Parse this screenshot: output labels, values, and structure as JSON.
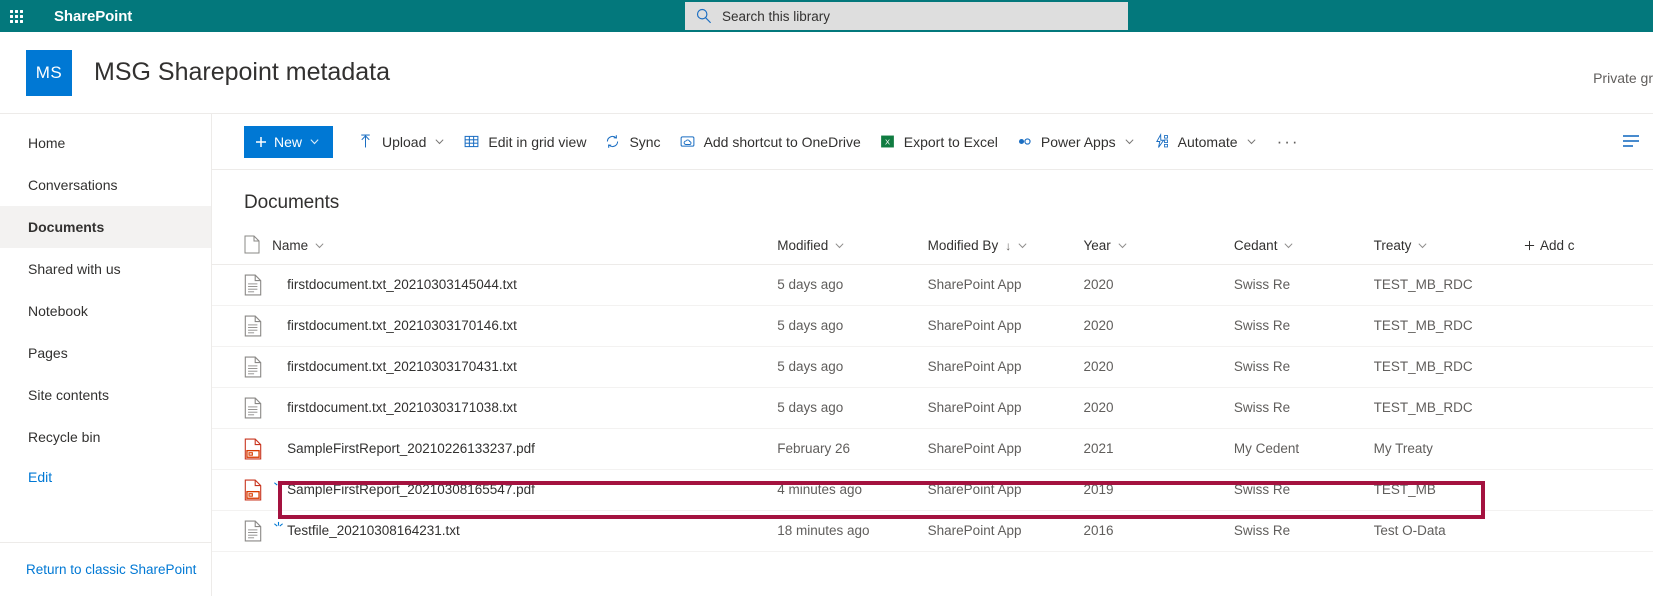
{
  "suite": {
    "waffle_label": "app-launcher",
    "brand": "SharePoint",
    "search_placeholder": "Search this library",
    "search_value": "",
    "accent": "#03787c"
  },
  "site": {
    "logo_initials": "MS",
    "logo_color": "#0078d4",
    "title": "MSG Sharepoint metadata",
    "privacy": "Private gr"
  },
  "sidebar": {
    "items": [
      {
        "label": "Home",
        "selected": false,
        "is_link": false
      },
      {
        "label": "Conversations",
        "selected": false,
        "is_link": false
      },
      {
        "label": "Documents",
        "selected": true,
        "is_link": false
      },
      {
        "label": "Shared with us",
        "selected": false,
        "is_link": false
      },
      {
        "label": "Notebook",
        "selected": false,
        "is_link": false
      },
      {
        "label": "Pages",
        "selected": false,
        "is_link": false
      },
      {
        "label": "Site contents",
        "selected": false,
        "is_link": false
      },
      {
        "label": "Recycle bin",
        "selected": false,
        "is_link": false
      },
      {
        "label": "Edit",
        "selected": false,
        "is_link": true
      }
    ],
    "footer_link": "Return to classic SharePoint"
  },
  "toolbar": {
    "new_label": "New",
    "upload_label": "Upload",
    "edit_grid_label": "Edit in grid view",
    "sync_label": "Sync",
    "shortcut_label": "Add shortcut to OneDrive",
    "export_label": "Export to Excel",
    "powerapps_label": "Power Apps",
    "automate_label": "Automate",
    "overflow_label": "···",
    "new_color": "#0078d4"
  },
  "list": {
    "title": "Documents",
    "columns": [
      {
        "key": "icon",
        "label": ""
      },
      {
        "key": "name",
        "label": "Name",
        "sorted": false
      },
      {
        "key": "mod",
        "label": "Modified",
        "sorted": false
      },
      {
        "key": "modby",
        "label": "Modified By",
        "sorted": true,
        "sort_dir": "↓"
      },
      {
        "key": "year",
        "label": "Year",
        "sorted": false
      },
      {
        "key": "cedant",
        "label": "Cedant",
        "sorted": false
      },
      {
        "key": "treaty",
        "label": "Treaty",
        "sorted": false
      }
    ],
    "add_column_label": "Add c",
    "rows": [
      {
        "name": "firstdocument.txt_20210303145044.txt",
        "type": "txt",
        "is_new": false,
        "modified": "5 days ago",
        "modified_by": "SharePoint App",
        "year": "2020",
        "cedant": "Swiss Re",
        "treaty": "TEST_MB_RDC",
        "highlighted": false
      },
      {
        "name": "firstdocument.txt_20210303170146.txt",
        "type": "txt",
        "is_new": false,
        "modified": "5 days ago",
        "modified_by": "SharePoint App",
        "year": "2020",
        "cedant": "Swiss Re",
        "treaty": "TEST_MB_RDC",
        "highlighted": false
      },
      {
        "name": "firstdocument.txt_20210303170431.txt",
        "type": "txt",
        "is_new": false,
        "modified": "5 days ago",
        "modified_by": "SharePoint App",
        "year": "2020",
        "cedant": "Swiss Re",
        "treaty": "TEST_MB_RDC",
        "highlighted": false
      },
      {
        "name": "firstdocument.txt_20210303171038.txt",
        "type": "txt",
        "is_new": false,
        "modified": "5 days ago",
        "modified_by": "SharePoint App",
        "year": "2020",
        "cedant": "Swiss Re",
        "treaty": "TEST_MB_RDC",
        "highlighted": false
      },
      {
        "name": "SampleFirstReport_20210226133237.pdf",
        "type": "pdf",
        "is_new": false,
        "modified": "February 26",
        "modified_by": "SharePoint App",
        "year": "2021",
        "cedant": "My Cedent",
        "treaty": "My Treaty",
        "highlighted": false
      },
      {
        "name": "SampleFirstReport_20210308165547.pdf",
        "type": "pdf",
        "is_new": true,
        "modified": "4 minutes ago",
        "modified_by": "SharePoint App",
        "year": "2019",
        "cedant": "Swiss Re",
        "treaty": "TEST_MB",
        "highlighted": true
      },
      {
        "name": "Testfile_20210308164231.txt",
        "type": "txt",
        "is_new": true,
        "modified": "18 minutes ago",
        "modified_by": "SharePoint App",
        "year": "2016",
        "cedant": "Swiss Re",
        "treaty": "Test O-Data",
        "highlighted": false
      }
    ],
    "highlight_color": "#a4123f"
  }
}
